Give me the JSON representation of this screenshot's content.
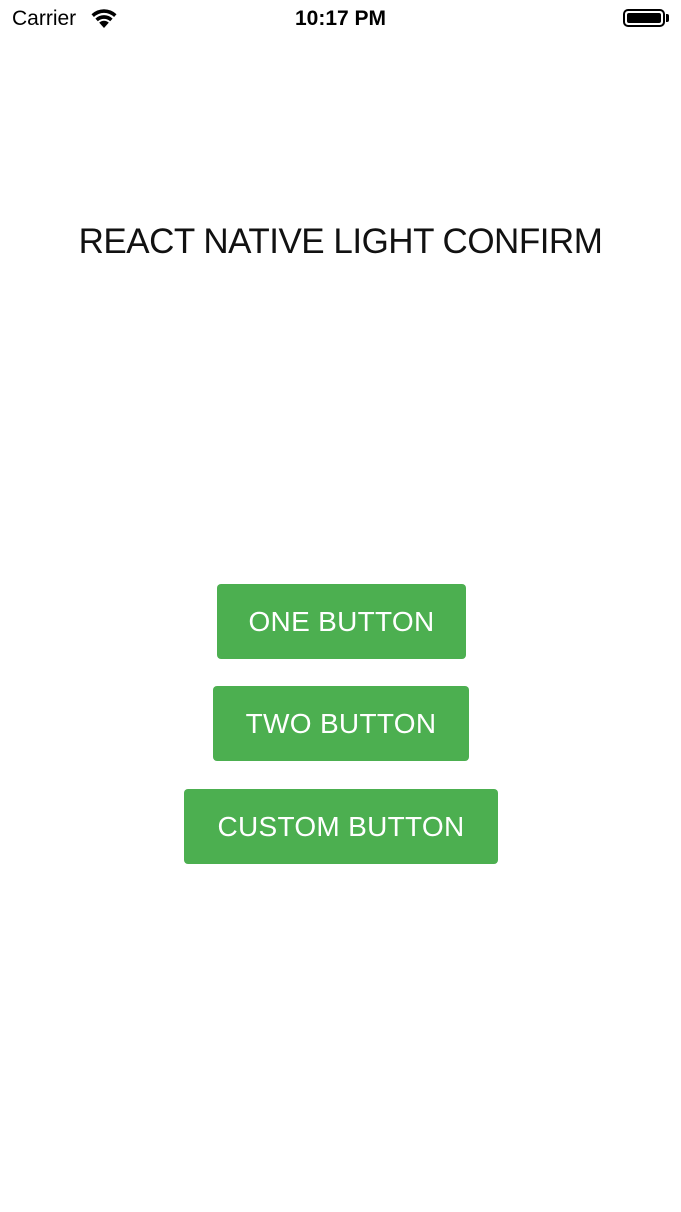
{
  "status_bar": {
    "carrier": "Carrier",
    "time": "10:17 PM",
    "wifi_icon": "wifi-icon",
    "battery_icon": "battery-full-icon"
  },
  "main": {
    "title": "REACT NATIVE LIGHT CONFIRM",
    "buttons": [
      {
        "label": "ONE BUTTON"
      },
      {
        "label": "TWO BUTTON"
      },
      {
        "label": "CUSTOM BUTTON"
      }
    ]
  },
  "colors": {
    "button_background": "#4caf50",
    "button_text": "#ffffff",
    "page_background": "#ffffff"
  }
}
